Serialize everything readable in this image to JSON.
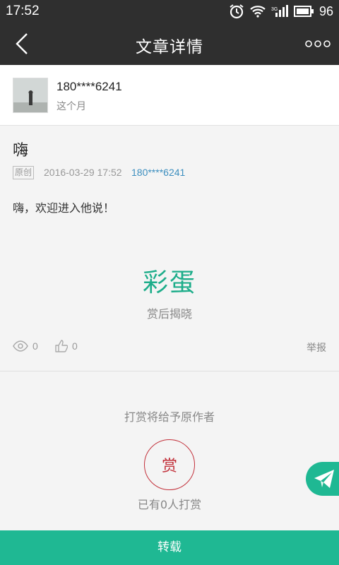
{
  "status_bar": {
    "time": "17:52",
    "battery": "96",
    "network": "3G"
  },
  "nav": {
    "title": "文章详情"
  },
  "author": {
    "name": "180****6241",
    "subtitle": "这个月"
  },
  "article": {
    "title": "嗨",
    "tag": "原创",
    "date": "2016-03-29 17:52",
    "author": "180****6241",
    "body": "嗨，欢迎进入他说！",
    "easter_title": "彩蛋",
    "easter_sub": "赏后揭晓",
    "views": "0",
    "likes": "0",
    "report": "举报"
  },
  "reward": {
    "note": "打赏将给予原作者",
    "button": "赏",
    "count": "已有0人打赏"
  },
  "bottom": {
    "label": "转载"
  },
  "colors": {
    "accent": "#1fb893",
    "reward": "#c2303a",
    "link": "#3d8fbf"
  }
}
